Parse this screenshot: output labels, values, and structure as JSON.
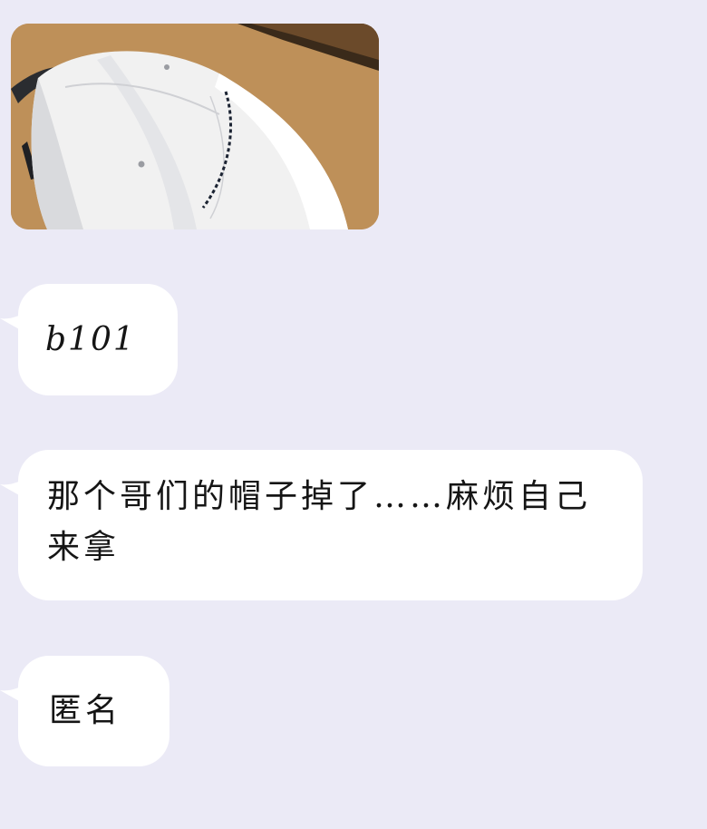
{
  "chat": {
    "messages": [
      {
        "type": "image",
        "subject": "white baseball cap on wooden table"
      },
      {
        "type": "text",
        "text": "b101"
      },
      {
        "type": "text",
        "text": "那个哥们的帽子掉了……麻烦自己来拿"
      },
      {
        "type": "text",
        "text": "匿名"
      }
    ]
  },
  "colors": {
    "background": "#ebeaf6",
    "bubble": "#ffffff",
    "text": "#151515"
  }
}
